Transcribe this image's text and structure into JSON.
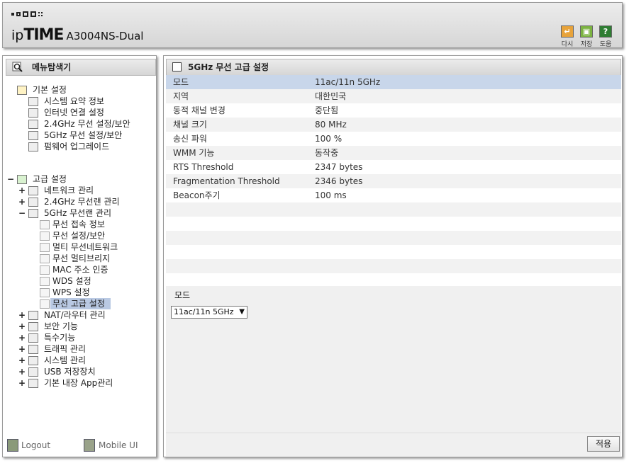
{
  "header": {
    "brand_prefix": "ip",
    "brand_main": "TIME",
    "model": "A3004NS-Dual",
    "buttons": [
      {
        "label": "다시",
        "icon": "refresh-icon",
        "color": "#e8a33a"
      },
      {
        "label": "저장",
        "icon": "save-icon",
        "color": "#7cb342"
      },
      {
        "label": "도움",
        "icon": "help-icon",
        "glyph": "?",
        "color": "#2e7d32"
      }
    ]
  },
  "sidebar": {
    "title": "메뉴탐색기",
    "basic": {
      "label": "기본 설정",
      "items": [
        "시스템 요약 정보",
        "인터넷 연결 설정",
        "2.4GHz 무선 설정/보안",
        "5GHz 무선 설정/보안",
        "펌웨어 업그레이드"
      ]
    },
    "advanced": {
      "toggle": "−",
      "label": "고급 설정",
      "groups": [
        {
          "toggle": "+",
          "label": "네트워크 관리"
        },
        {
          "toggle": "+",
          "label": "2.4GHz 무선랜 관리"
        },
        {
          "toggle": "−",
          "label": "5GHz 무선랜 관리"
        }
      ],
      "wifi5_items": [
        "무선 접속 정보",
        "무선 설정/보안",
        "멀티 무선네트워크",
        "무선 멀티브리지",
        "MAC 주소 인증",
        "WDS 설정",
        "WPS 설정",
        "무선 고급 설정"
      ],
      "more_groups": [
        {
          "toggle": "+",
          "label": "NAT/라우터 관리"
        },
        {
          "toggle": "+",
          "label": "보안 기능"
        },
        {
          "toggle": "+",
          "label": "특수기능"
        },
        {
          "toggle": "+",
          "label": "트래픽 관리"
        },
        {
          "toggle": "+",
          "label": "시스템 관리"
        },
        {
          "toggle": "+",
          "label": "USB 저장장치"
        },
        {
          "toggle": "+",
          "label": "기본 내장 App관리"
        }
      ]
    },
    "logout": "Logout",
    "mobile": "Mobile UI"
  },
  "main": {
    "title": "5GHz 무선 고급 설정",
    "rows": [
      {
        "key": "모드",
        "value": "11ac/11n 5GHz"
      },
      {
        "key": "지역",
        "value": "대한민국"
      },
      {
        "key": "동적 채널 변경",
        "value": "중단됨"
      },
      {
        "key": "채널 크기",
        "value": "80 MHz"
      },
      {
        "key": "송신 파워",
        "value": "100 %"
      },
      {
        "key": "WMM 기능",
        "value": "동작중"
      },
      {
        "key": "RTS Threshold",
        "value": "2347 bytes"
      },
      {
        "key": "Fragmentation Threshold",
        "value": "2346 bytes"
      },
      {
        "key": "Beacon주기",
        "value": "100 ms"
      },
      {
        "key": "",
        "value": ""
      },
      {
        "key": "",
        "value": ""
      },
      {
        "key": "",
        "value": ""
      },
      {
        "key": "",
        "value": ""
      },
      {
        "key": "",
        "value": ""
      },
      {
        "key": "",
        "value": ""
      }
    ],
    "edit_label": "모드",
    "mode_select": "11ac/11n 5GHz",
    "apply": "적용"
  }
}
